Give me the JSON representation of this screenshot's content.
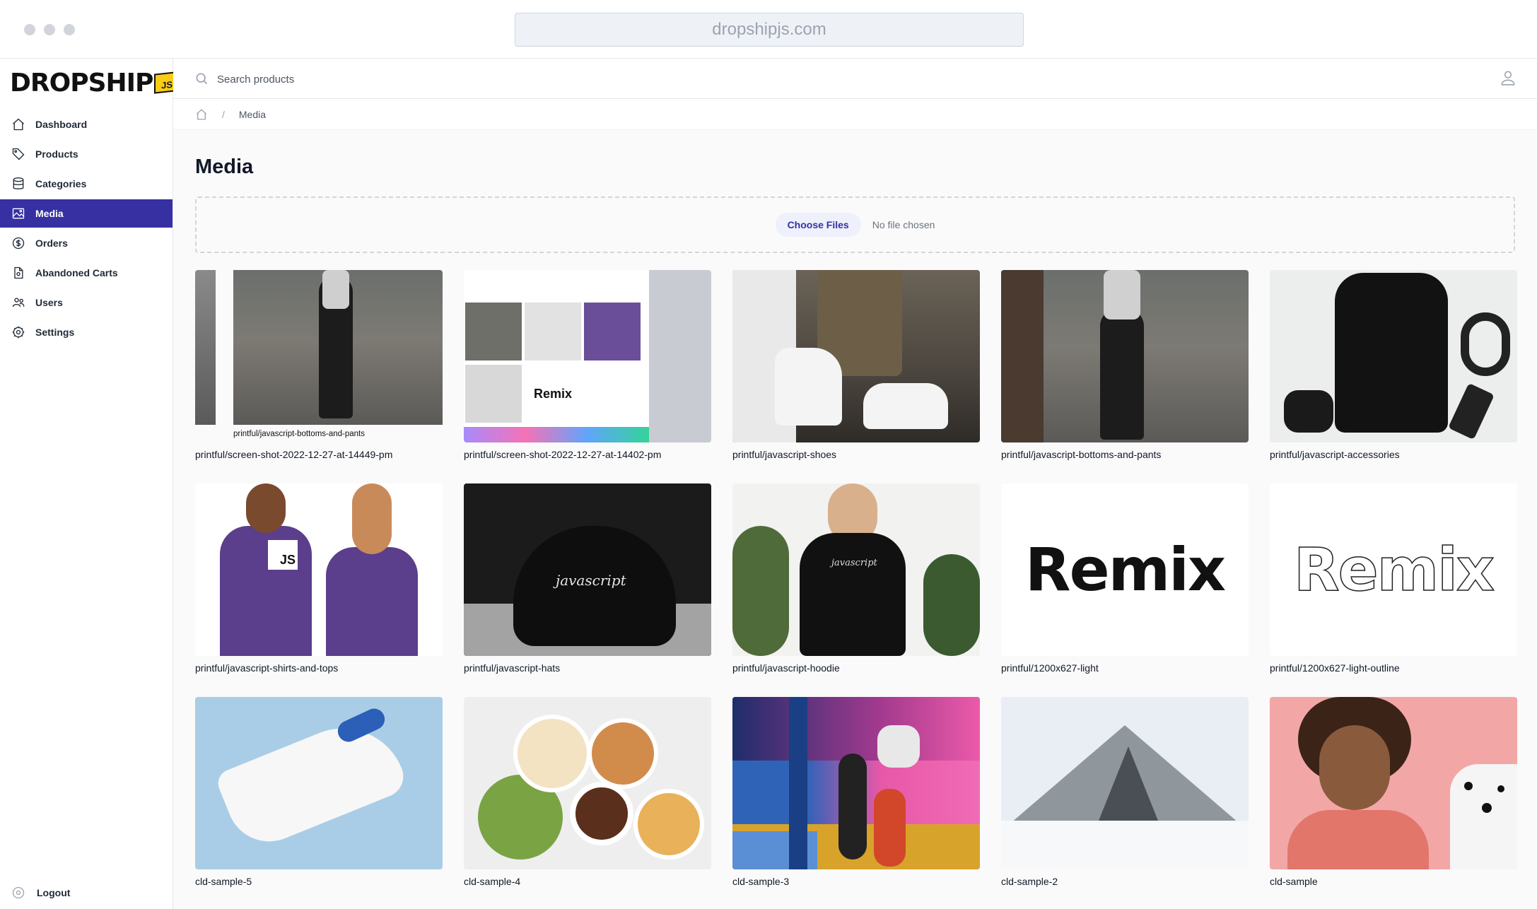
{
  "browser": {
    "url": "dropshipjs.com"
  },
  "brand": {
    "name": "DROPSHIP",
    "badge": "JS"
  },
  "sidebar": {
    "items": [
      {
        "label": "Dashboard",
        "icon": "home-icon",
        "active": false
      },
      {
        "label": "Products",
        "icon": "tag-icon",
        "active": false
      },
      {
        "label": "Categories",
        "icon": "database-icon",
        "active": false
      },
      {
        "label": "Media",
        "icon": "image-icon",
        "active": true
      },
      {
        "label": "Orders",
        "icon": "dollar-icon",
        "active": false
      },
      {
        "label": "Abandoned Carts",
        "icon": "document-icon",
        "active": false
      },
      {
        "label": "Users",
        "icon": "users-icon",
        "active": false
      },
      {
        "label": "Settings",
        "icon": "gear-icon",
        "active": false
      }
    ],
    "logout": "Logout"
  },
  "search": {
    "placeholder": "Search products"
  },
  "breadcrumb": {
    "current": "Media"
  },
  "page": {
    "title": "Media"
  },
  "upload": {
    "button": "Choose Files",
    "status": "No file chosen"
  },
  "media": [
    {
      "caption": "printful/screen-shot-2022-12-27-at-14449-pm",
      "inner_caption": "printful/javascript-bottoms-and-pants",
      "kind": "screenshot-pants"
    },
    {
      "caption": "printful/screen-shot-2022-12-27-at-14402-pm",
      "kind": "screenshot-grid",
      "inner_text": "Remix"
    },
    {
      "caption": "printful/javascript-shoes",
      "kind": "shoes"
    },
    {
      "caption": "printful/javascript-bottoms-and-pants",
      "kind": "pants"
    },
    {
      "caption": "printful/javascript-accessories",
      "kind": "backpack"
    },
    {
      "caption": "printful/javascript-shirts-and-tops",
      "kind": "shirts",
      "inner_text": "JS"
    },
    {
      "caption": "printful/javascript-hats",
      "kind": "hat",
      "inner_text": "javascript"
    },
    {
      "caption": "printful/javascript-hoodie",
      "kind": "hoodie",
      "inner_text": "javascript"
    },
    {
      "caption": "printful/1200x627-light",
      "kind": "remix-solid",
      "inner_text": "Remix"
    },
    {
      "caption": "printful/1200x627-light-outline",
      "kind": "remix-outline",
      "inner_text": "Remix"
    },
    {
      "caption": "cld-sample-5",
      "kind": "sneaker"
    },
    {
      "caption": "cld-sample-4",
      "kind": "food"
    },
    {
      "caption": "cld-sample-3",
      "kind": "basketball"
    },
    {
      "caption": "cld-sample-2",
      "kind": "mountain"
    },
    {
      "caption": "cld-sample",
      "kind": "woman-dog"
    }
  ],
  "colors": {
    "accent": "#3730a3",
    "accent_light": "#eef0fb"
  }
}
